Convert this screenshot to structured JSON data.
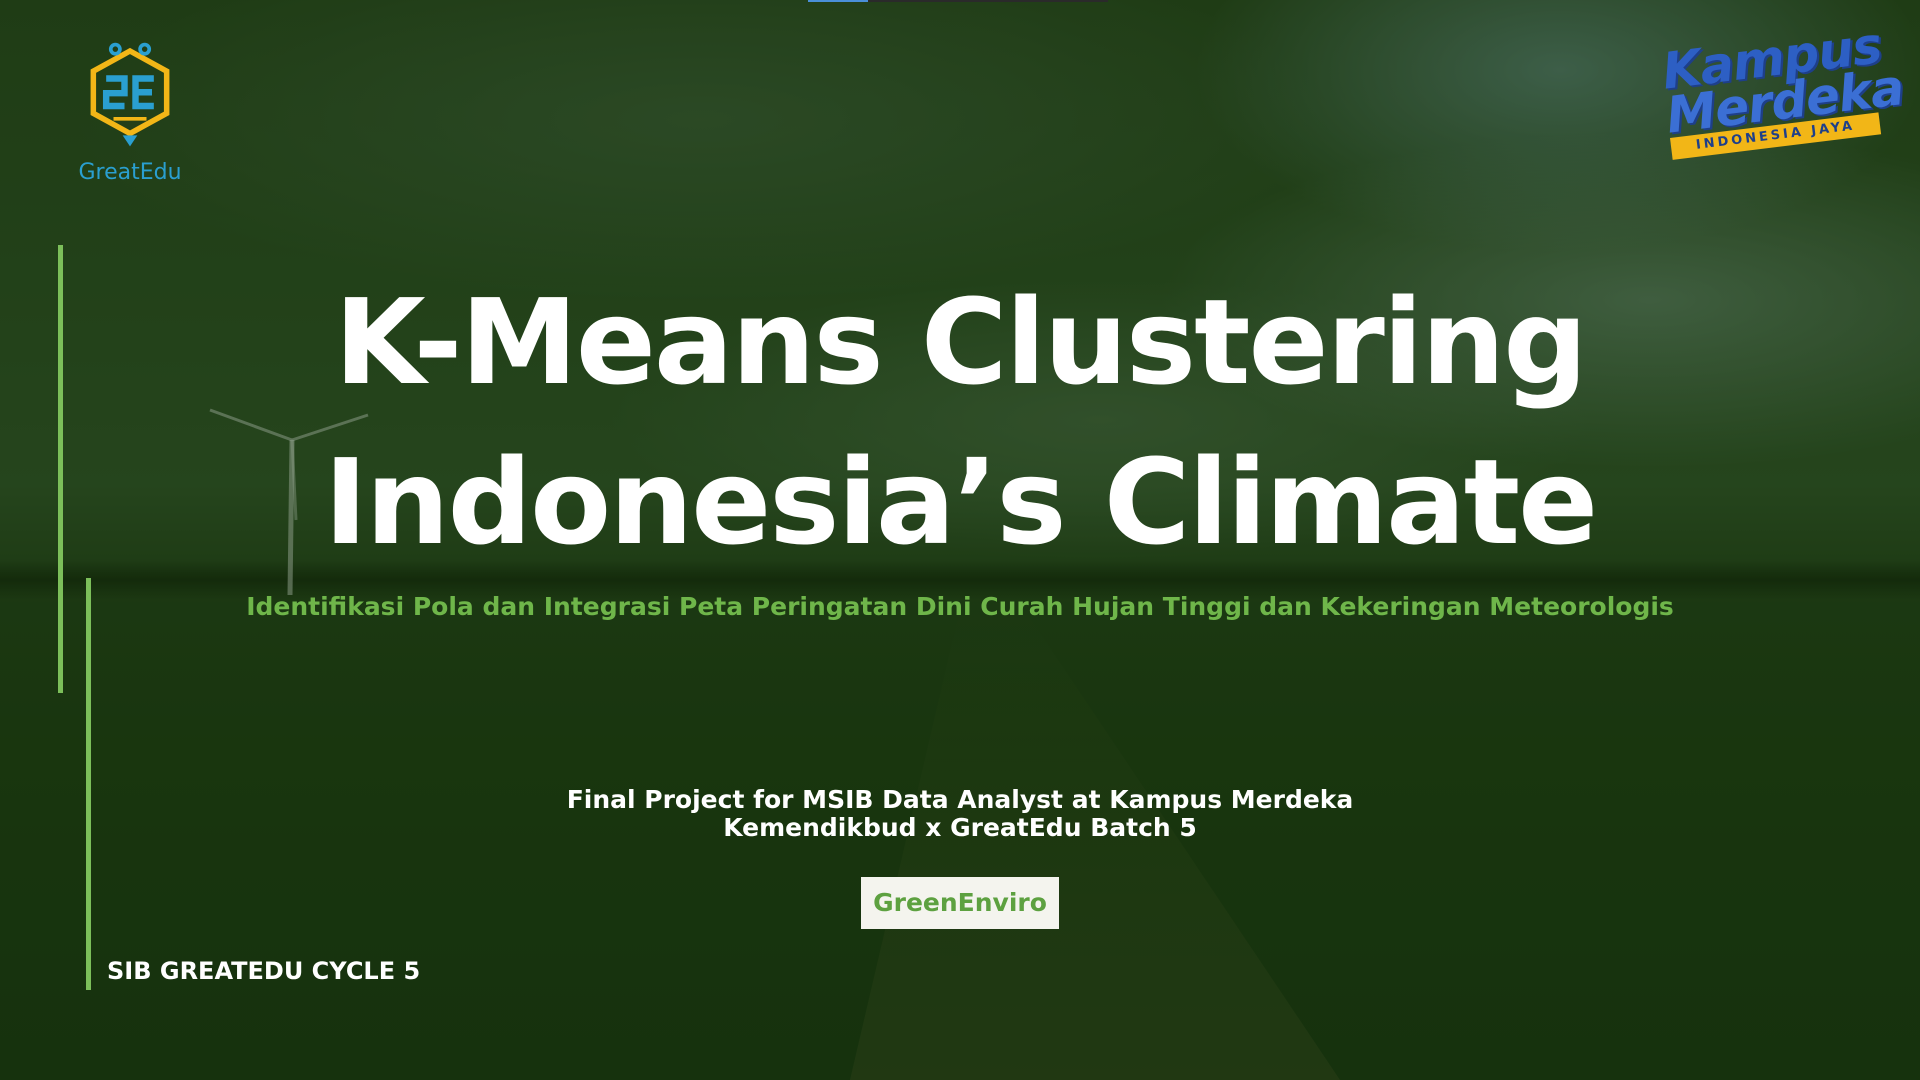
{
  "slide": {
    "brand_left": {
      "name": "GreatEdu",
      "icon": "greatedu-logo-icon",
      "color": "#2a9fd0",
      "accent": "#f2b617"
    },
    "brand_right": {
      "line1": "Kampus",
      "line2": "Merdeka",
      "ribbon": "INDONESIA JAYA",
      "color": "#2d5fc4",
      "ribbon_color": "#f2b617"
    },
    "title_line1": "K-Means Clustering",
    "title_line2": "Indonesia’s Climate",
    "subtitle": "Identifikasi Pola dan Integrasi Peta Peringatan Dini Curah Hujan Tinggi dan Kekeringan Meteorologis",
    "project_line1": "Final Project for MSIB Data Analyst at Kampus Merdeka",
    "project_line2": "Kemendikbud x GreatEdu Batch 5",
    "team_name": "GreenEnviro",
    "cycle_label": "SIB GREATEDU CYCLE 5",
    "accent_color": "#6fb64a",
    "background": "stormy sky over dark green field with wind turbine"
  }
}
